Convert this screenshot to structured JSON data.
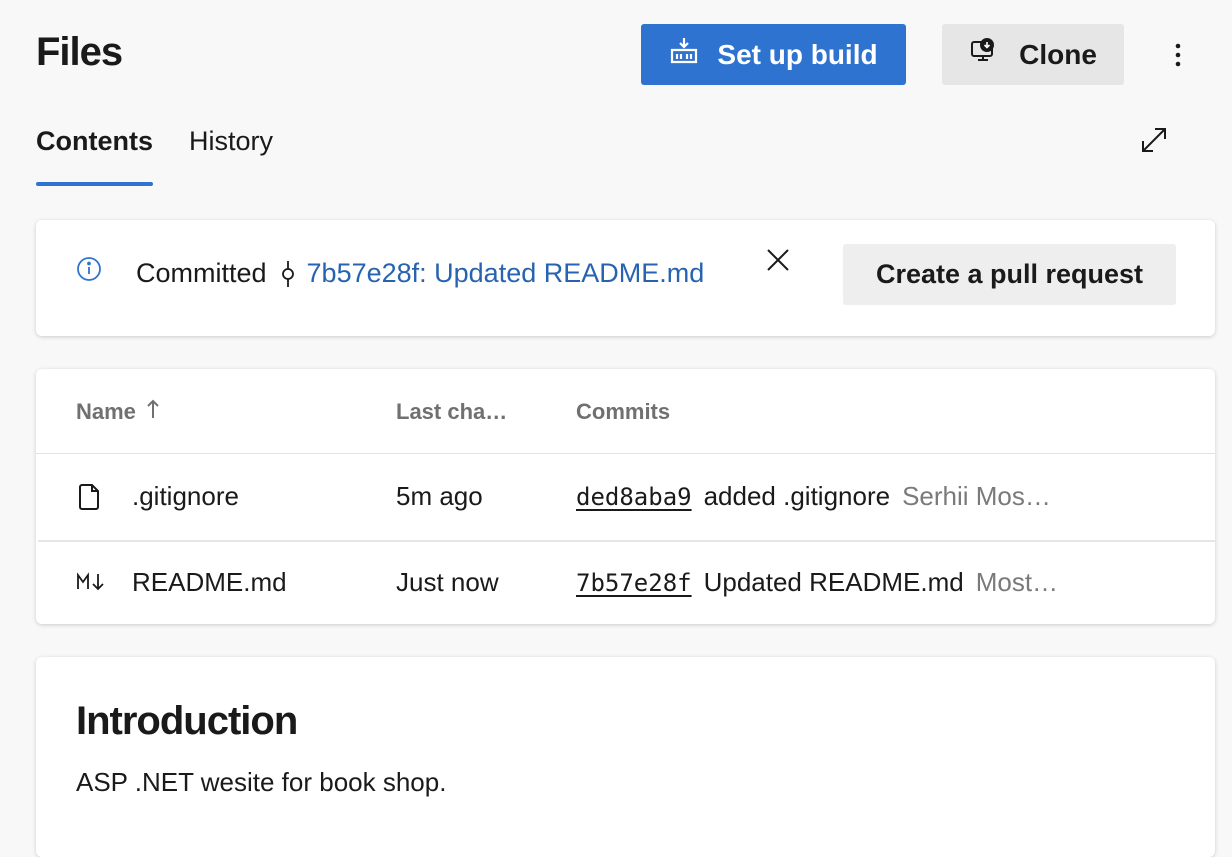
{
  "header": {
    "title": "Files"
  },
  "toolbar": {
    "setup_build_label": "Set up build",
    "clone_label": "Clone",
    "more_icon": "more-vertical-icon"
  },
  "tabs": [
    {
      "label": "Contents",
      "active": true
    },
    {
      "label": "History",
      "active": false
    }
  ],
  "banner": {
    "status_text": "Committed",
    "commit_link": "7b57e28f: Updated README.md",
    "pr_button_label": "Create a pull request"
  },
  "files_table": {
    "columns": [
      {
        "label": "Name",
        "sort": "ascending"
      },
      {
        "label": "Last cha…"
      },
      {
        "label": "Commits"
      }
    ],
    "rows": [
      {
        "icon": "file-icon",
        "name": ".gitignore",
        "last_change": "5m ago",
        "commit_hash": "ded8aba9",
        "commit_message": "added .gitignore",
        "author": "Serhii Mos…"
      },
      {
        "icon": "markdown-icon",
        "name": "README.md",
        "last_change": "Just now",
        "commit_hash": "7b57e28f",
        "commit_message": "Updated README.md",
        "author": "Most…"
      }
    ]
  },
  "readme": {
    "heading": "Introduction",
    "body": "ASP .NET wesite for book shop."
  },
  "colors": {
    "accent": "#2f73d1",
    "link": "#2763b0",
    "page_bg": "#f8f8f8"
  }
}
